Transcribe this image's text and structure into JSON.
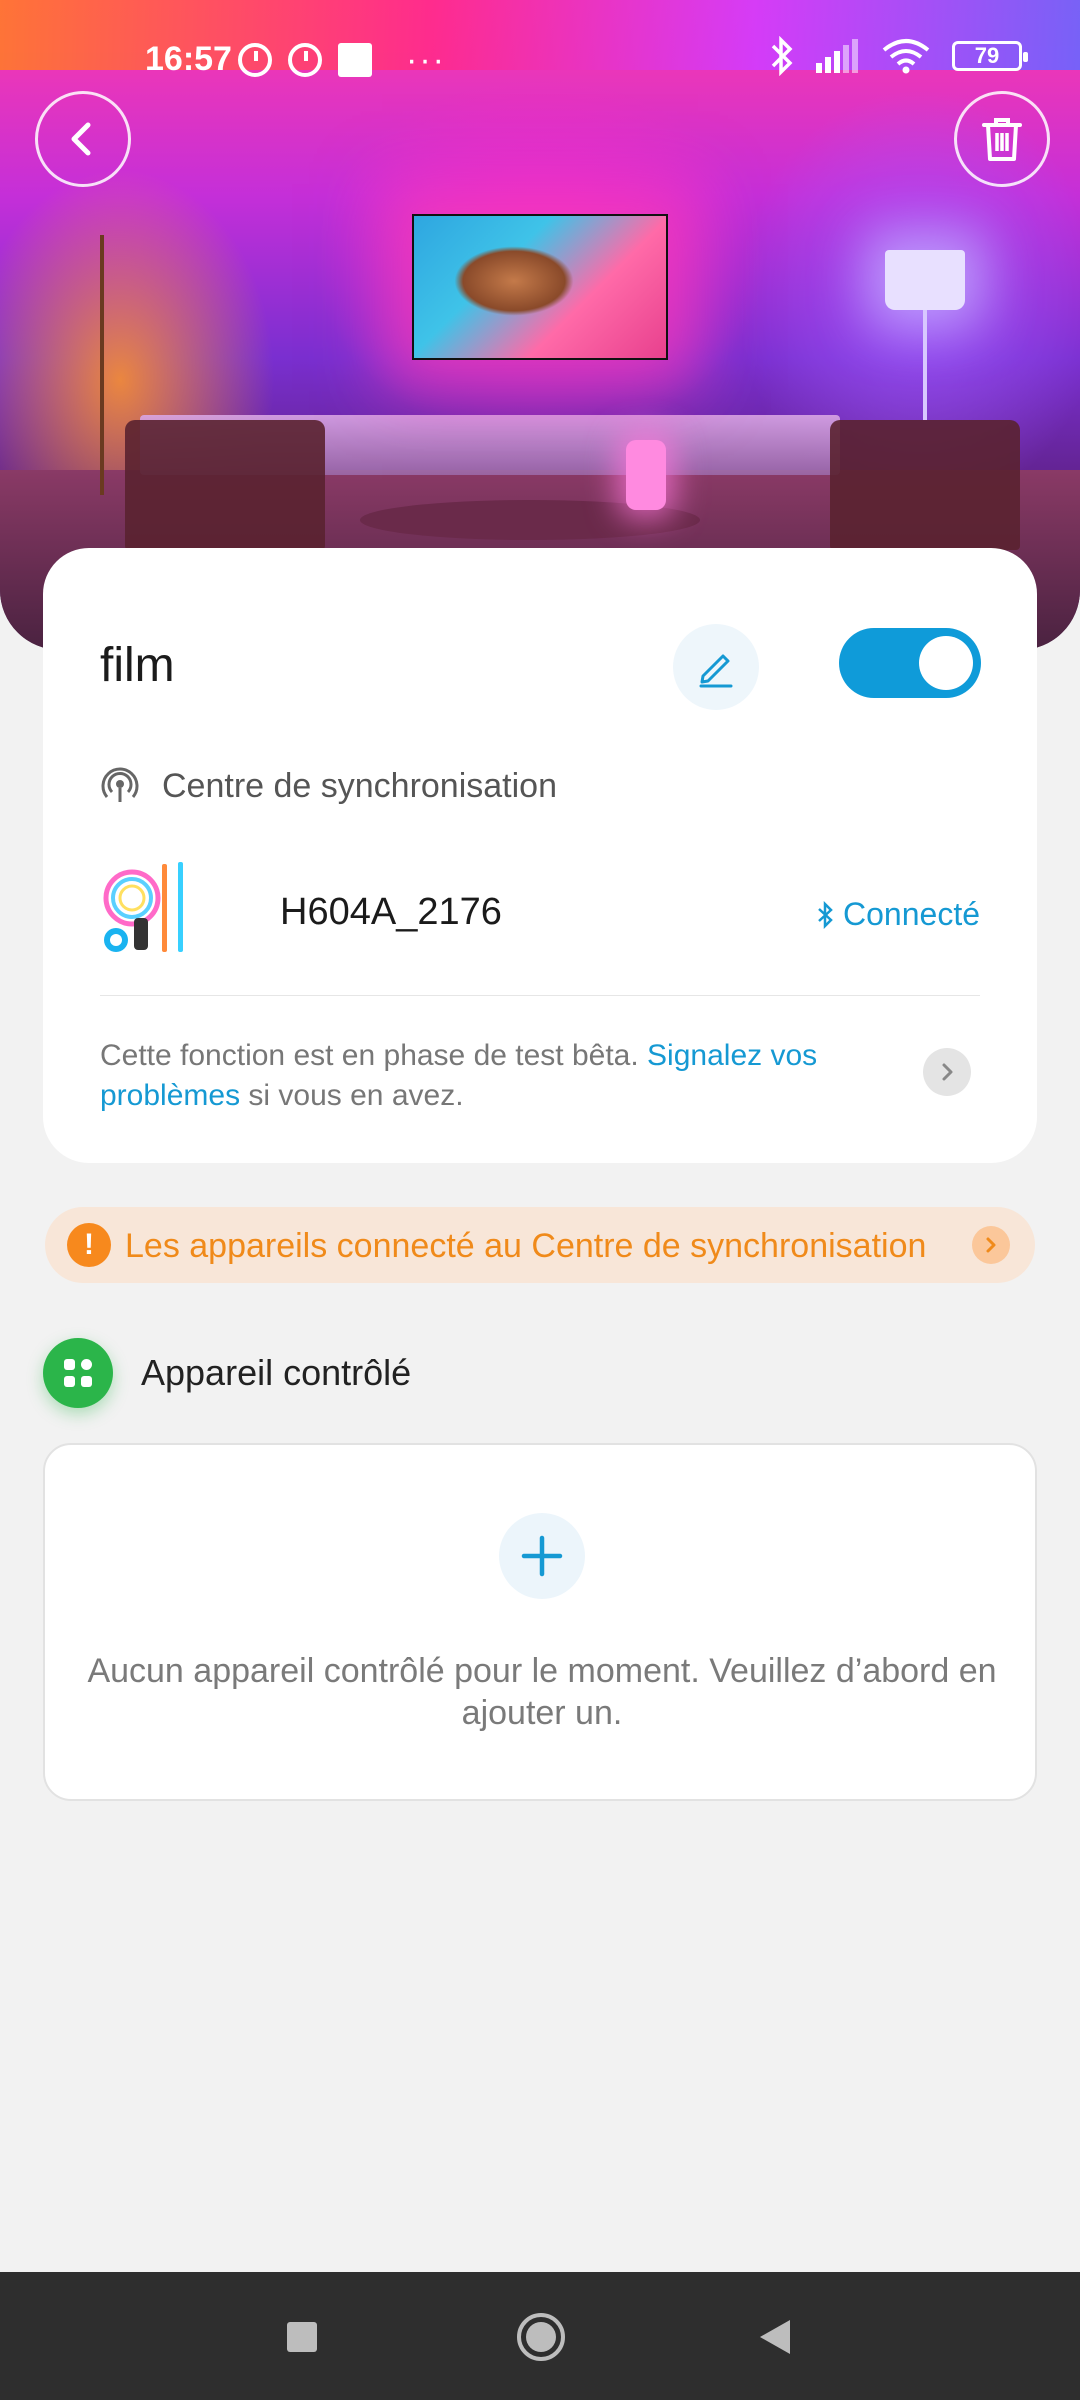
{
  "status_bar": {
    "time": "16:57",
    "battery": "79",
    "more_dots": "···"
  },
  "header": {
    "back_icon": "chevron-left-icon",
    "delete_icon": "trash-icon"
  },
  "scene_card": {
    "title": "film",
    "edit_icon": "pencil-icon",
    "toggle_on": true,
    "sync_center_label": "Centre de synchronisation",
    "device": {
      "name": "H604A_2176",
      "status": "Connecté",
      "status_icon": "bluetooth-icon"
    },
    "beta_text_1": "Cette fonction est en phase de test bêta.",
    "beta_link": "Signalez vos problèmes",
    "beta_text_2": "si vous en avez."
  },
  "warning_banner": {
    "text": "Les appareils connecté au Centre de synchronisation"
  },
  "controlled_section": {
    "title": "Appareil contrôlé",
    "empty_text": "Aucun appareil contrôlé pour le moment. Veuillez d’abord en ajouter un."
  },
  "colors": {
    "accent": "#1599d3",
    "warning": "#f08a1a",
    "green": "#2bb54a"
  }
}
